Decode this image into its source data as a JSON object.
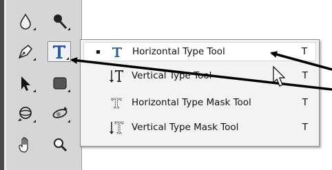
{
  "flyout": {
    "items": [
      {
        "label": "Horizontal Type Tool",
        "shortcut": "T",
        "icon": "horizontal-type-icon"
      },
      {
        "label": "Vertical Type Tool",
        "shortcut": "T",
        "icon": "vertical-type-icon"
      },
      {
        "label": "Horizontal Type Mask Tool",
        "shortcut": "T",
        "icon": "horizontal-type-mask-icon"
      },
      {
        "label": "Vertical Type Mask Tool",
        "shortcut": "T",
        "icon": "vertical-type-mask-icon"
      }
    ],
    "selected_index": 0
  },
  "toolbar": {
    "tools": [
      "blur-icon",
      "dodge-icon",
      "pen-icon",
      "type-icon",
      "path-selection-icon",
      "rectangle-icon",
      "3d-rotate-icon",
      "3d-orbit-icon",
      "hand-icon",
      "zoom-icon"
    ]
  },
  "colors": {
    "toolbar_bg": "#d6d6d6",
    "flyout_bg": "#f3f3f3",
    "type_icon_blue": "#2a5d9e",
    "callout_arrow": "#000000"
  }
}
